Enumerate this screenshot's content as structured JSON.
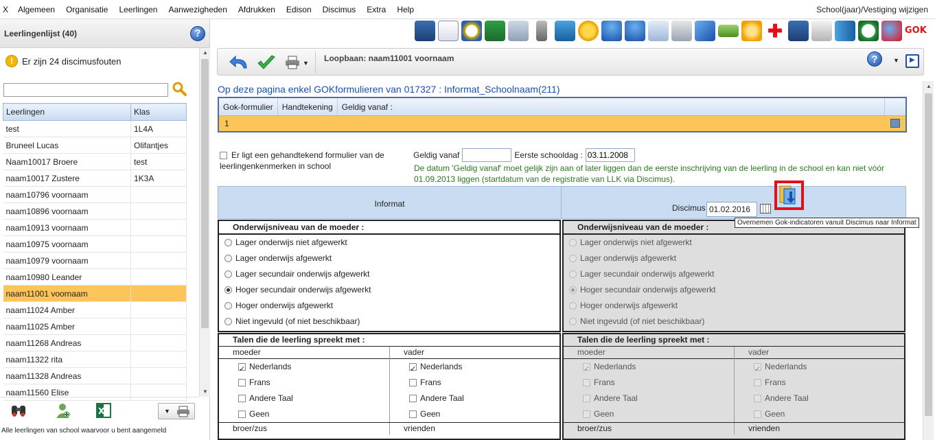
{
  "menu": {
    "items": [
      "X",
      "Algemeen",
      "Organisatie",
      "Leerlingen",
      "Aanwezigheden",
      "Afdrukken",
      "Edison",
      "Discimus",
      "Extra",
      "Help"
    ],
    "right": "School(jaar)/Vestiging wijzigen"
  },
  "left": {
    "title": "Leerlingenlijst (40)",
    "help_icon": "?",
    "warning": "Er zijn 24 discimusfouten",
    "warning_icon": "!",
    "search_value": "",
    "columns": [
      "Leerlingen",
      "Klas"
    ],
    "rows": [
      {
        "name": "test",
        "klas": "1L4A"
      },
      {
        "name": "Bruneel Lucas",
        "klas": "Olifantjes"
      },
      {
        "name": "Naam10017 Broere",
        "klas": "test"
      },
      {
        "name": "naam10017 Zustere",
        "klas": "1K3A"
      },
      {
        "name": "naam10796 voornaam",
        "klas": ""
      },
      {
        "name": "naam10896 voornaam",
        "klas": ""
      },
      {
        "name": "naam10913 voornaam",
        "klas": ""
      },
      {
        "name": "naam10975 voornaam",
        "klas": ""
      },
      {
        "name": "naam10979 voornaam",
        "klas": ""
      },
      {
        "name": "naam10980 Leander",
        "klas": ""
      },
      {
        "name": "naam11001 voornaam",
        "klas": ""
      },
      {
        "name": "naam11024 Amber",
        "klas": ""
      },
      {
        "name": "naam11025 Amber",
        "klas": ""
      },
      {
        "name": "naam11268 Andreas",
        "klas": ""
      },
      {
        "name": "naam11322 rita",
        "klas": ""
      },
      {
        "name": "naam11328 Andreas",
        "klas": ""
      },
      {
        "name": "naam11560 Elise",
        "klas": ""
      }
    ],
    "selected_index": 10,
    "footer": "Alle leerlingen van school waarvoor u bent aangemeld"
  },
  "toolbar": {
    "title": "Loopbaan: naam11001 voornaam",
    "help_icon": "?"
  },
  "main": {
    "title": "Op deze pagina enkel GOKformulieren van 017327 : Informat_Schoolnaam(211)",
    "gok_columns": [
      "Gok-formulier",
      "Handtekening",
      "Geldig vanaf :"
    ],
    "gok_row": "1",
    "handtekening_label": "Er ligt een gehandtekend formulier van de leerlingenkenmerken in school",
    "geldig_vanaf_label": "Geldig vanaf",
    "geldig_vanaf_value": "",
    "eerste_schooldag_label": "Eerste schooldag :",
    "eerste_schooldag_value": "03.11.2008",
    "note": "De datum 'Geldig vanaf' moet gelijk zijn aan of later liggen dan de eerste inschrijving van de leerling in de school en kan niet vóór 01.09.2013 liggen (startdatum van de registratie van LLK via Discimus).",
    "col_informat": "Informat",
    "col_discimus": "Discimus",
    "discimus_date": "01.02.2016",
    "tooltip": "Overnemen Gok-indicatoren vanuit Discimus naar Informat",
    "onderwijs": {
      "title": "Onderwijsniveau van de moeder :",
      "options": [
        "Lager onderwijs niet afgewerkt",
        "Lager onderwijs afgewerkt",
        "Lager secundair onderwijs afgewerkt",
        "Hoger secundair onderwijs afgewerkt",
        "Hoger onderwijs afgewerkt",
        "Niet ingevuld (of niet beschikbaar)"
      ],
      "selected": 3
    },
    "talen": {
      "title": "Talen die de leerling spreekt met :",
      "col1": "moeder",
      "col2": "vader",
      "options": [
        "Nederlands",
        "Frans",
        "Andere Taal",
        "Geen"
      ],
      "checked": [
        true,
        false,
        false,
        false
      ],
      "foot1": "broer/zus",
      "foot2": "vrienden"
    }
  },
  "colors": {
    "accent_blue": "#1a4fb5",
    "selection": "#fbc55a",
    "note_green": "#2a7a1e",
    "highlight_red": "#e3101a"
  }
}
